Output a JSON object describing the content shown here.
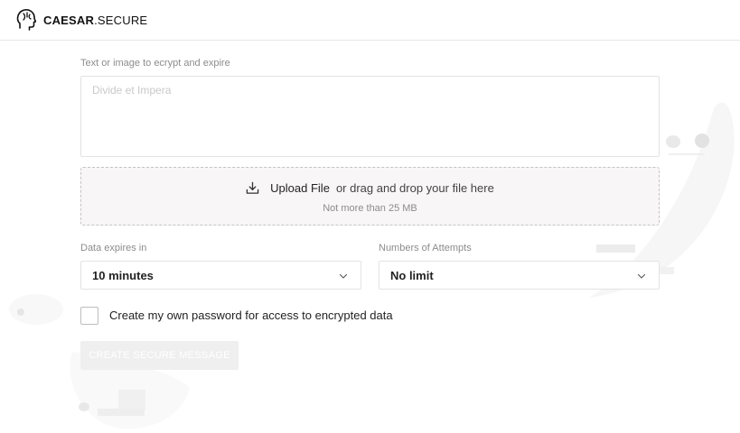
{
  "header": {
    "logo_icon": "helmet-head-icon",
    "brand_bold": "CAESAR",
    "brand_light": ".SECURE"
  },
  "form": {
    "text_label": "Text or image to ecrypt and expire",
    "text_placeholder": "Divide et Impera",
    "text_value": "",
    "upload": {
      "icon": "download-icon",
      "link": "Upload File",
      "hint": "or drag and drop your file here",
      "limit": "Not more than 25 MB"
    },
    "expires": {
      "label": "Data expires in",
      "value": "10 minutes"
    },
    "attempts": {
      "label": "Numbers of Attempts",
      "value": "No limit"
    },
    "password_checkbox": {
      "checked": false,
      "label": "Create my own password for access to encrypted data"
    },
    "submit_label": "CREATE SECURE MESSAGE"
  },
  "colors": {
    "border": "#e3e3e3",
    "dropzone_bg": "#f8f6f6",
    "muted_text": "#8c8c8c",
    "disabled_button": "#efefef"
  }
}
